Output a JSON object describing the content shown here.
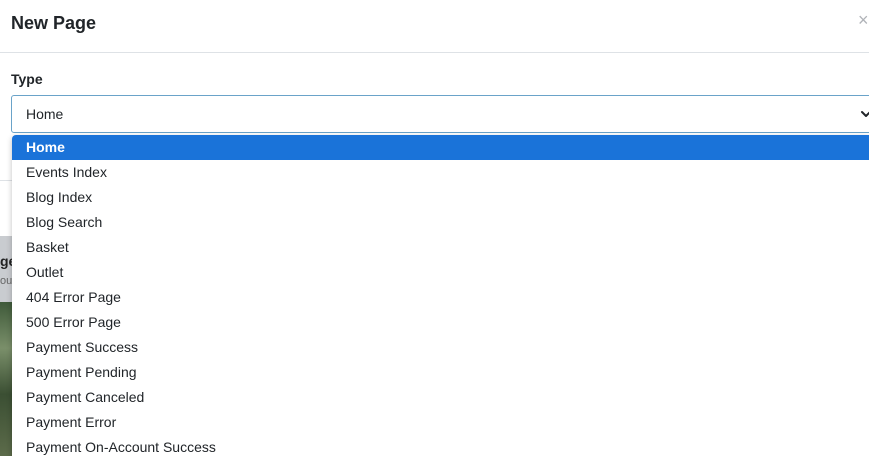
{
  "modal": {
    "title": "New Page",
    "close_symbol": "×"
  },
  "form": {
    "type_label": "Type",
    "type_selected": "Home"
  },
  "dropdown": {
    "options": [
      "Home",
      "Events Index",
      "Blog Index",
      "Blog Search",
      "Basket",
      "Outlet",
      "404 Error Page",
      "500 Error Page",
      "Payment Success",
      "Payment Pending",
      "Payment Canceled",
      "Payment Error",
      "Payment On-Account Success"
    ],
    "selected_index": 0
  },
  "background": {
    "fragment_1": "ge",
    "fragment_2": "ou"
  },
  "colors": {
    "selected_option_bg": "#1a73d9",
    "select_border": "#6aa3c9"
  }
}
